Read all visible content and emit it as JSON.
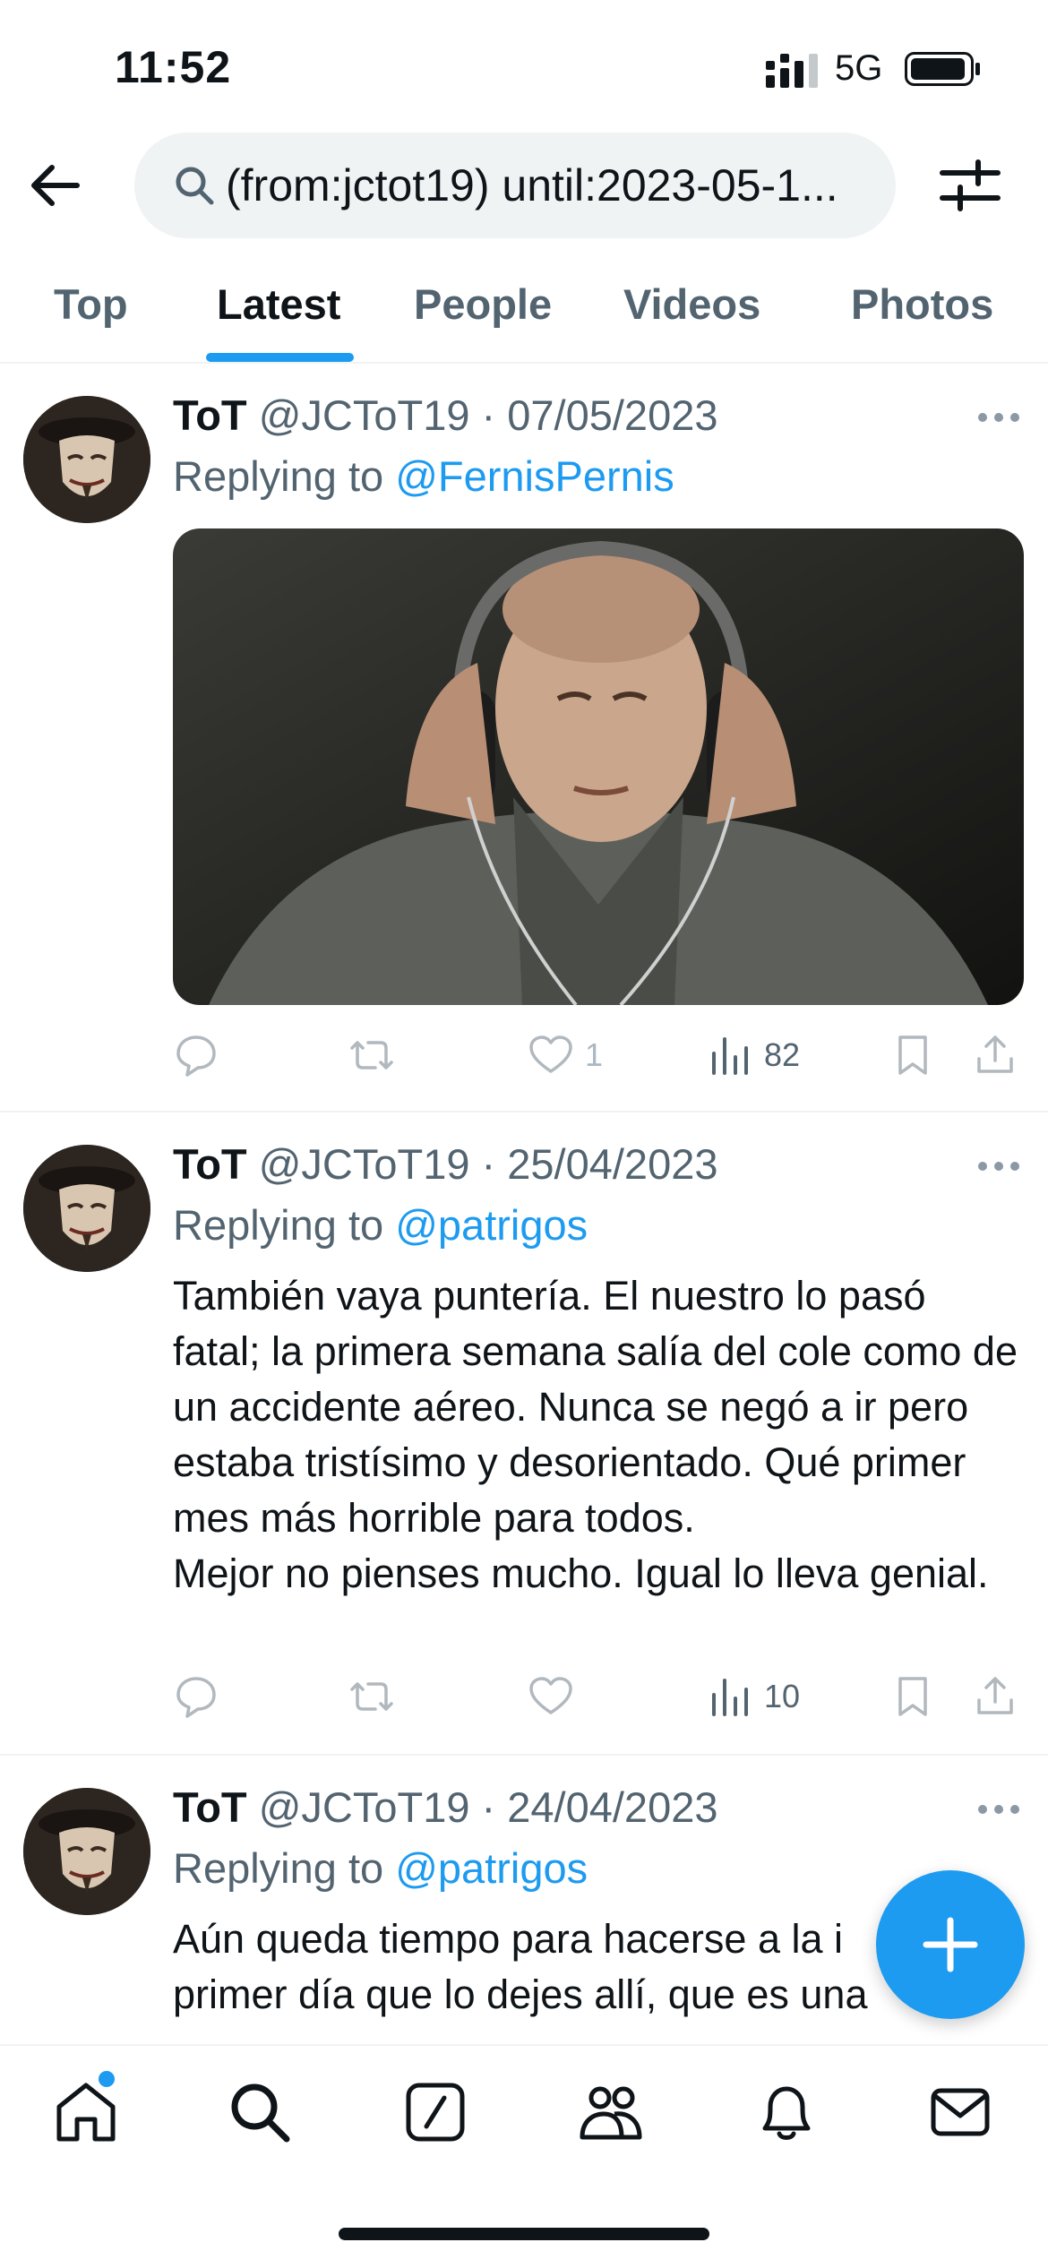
{
  "status_bar": {
    "time": "11:52",
    "network": "5G"
  },
  "search": {
    "query": "(from:jctot19) until:2023-05-1..."
  },
  "tabs": [
    {
      "label": "Top"
    },
    {
      "label": "Latest"
    },
    {
      "label": "People"
    },
    {
      "label": "Videos"
    },
    {
      "label": "Photos"
    }
  ],
  "active_tab": "Latest",
  "tweets": [
    {
      "name": "ToT",
      "handle": "@JCToT19",
      "date": "· 07/05/2023",
      "replying_prefix": "Replying to ",
      "replying_to": "@FernisPernis",
      "text": "",
      "has_media": true,
      "likes": "1",
      "views": "82"
    },
    {
      "name": "ToT",
      "handle": "@JCToT19",
      "date": "· 25/04/2023",
      "replying_prefix": "Replying to ",
      "replying_to": "@patrigos",
      "text": "También vaya puntería. El nuestro lo pasó fatal; la primera semana salía del cole como de un accidente aéreo. Nunca se negó a ir pero estaba tristísimo y desorientado. Qué primer mes más horrible para todos.\nMejor no pienses mucho. Igual lo lleva genial.",
      "has_media": false,
      "likes": "",
      "views": "10"
    },
    {
      "name": "ToT",
      "handle": "@JCToT19",
      "date": "· 24/04/2023",
      "replying_prefix": "Replying to ",
      "replying_to": "@patrigos",
      "text": "Aún queda tiempo para hacerse a la i\nprimer día que lo dejes allí, que es una",
      "has_media": false,
      "likes": "",
      "views": ""
    }
  ],
  "colors": {
    "accent": "#1d9bf0",
    "text": "#0f1419",
    "muted": "#536471",
    "search_bg": "#eff3f4"
  },
  "icons": {
    "nav": [
      "home-icon",
      "search-icon",
      "compose-icon",
      "communities-icon",
      "notifications-icon",
      "messages-icon"
    ]
  }
}
